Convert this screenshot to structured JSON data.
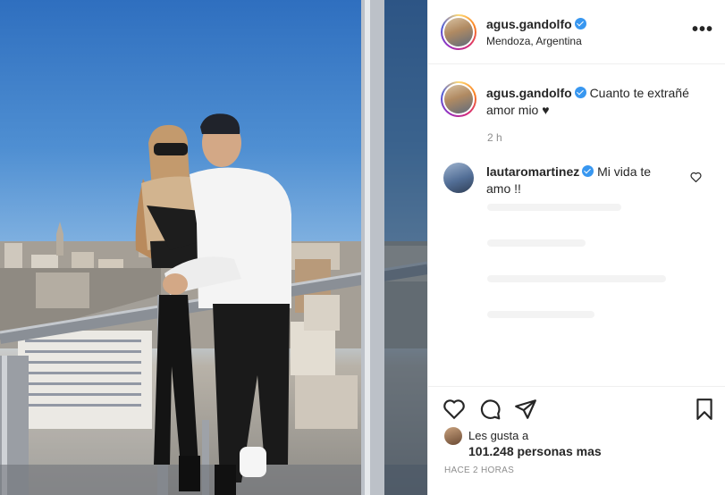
{
  "post": {
    "author": "agus.gandolfo",
    "location": "Mendoza, Argentina",
    "more_icon": "more-options-icon",
    "verified_icon": "verified-badge-icon"
  },
  "caption": {
    "author": "agus.gandolfo",
    "text": "Cuanto te extrañé amor mio ♥",
    "time": "2 h"
  },
  "comments": [
    {
      "author": "lautaromartinez",
      "text": "Mi vida te amo !!",
      "like_icon": "heart-outline-icon"
    }
  ],
  "actions": {
    "like_icon": "heart-outline-icon",
    "comment_icon": "speech-bubble-icon",
    "share_icon": "paper-plane-icon",
    "save_icon": "bookmark-icon"
  },
  "likes": {
    "prefix": "Les gusta a",
    "count_text": "101.248 personas mas"
  },
  "timestamp": "HACE 2 HORAS",
  "colors": {
    "verified": "#3897f0",
    "border": "#efefef",
    "muted_text": "#8e8e8e"
  }
}
